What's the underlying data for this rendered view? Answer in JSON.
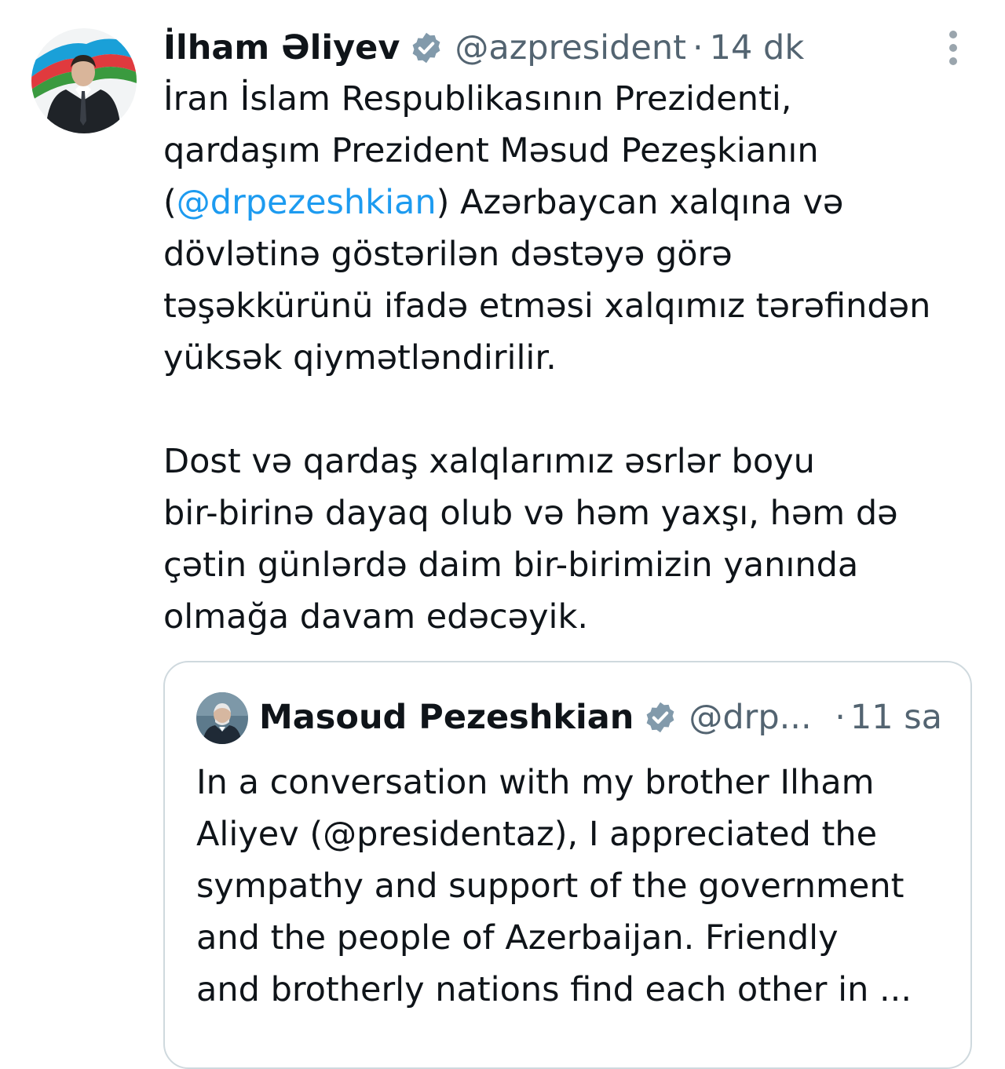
{
  "tweet": {
    "author": {
      "display_name": "İlham Əliyev",
      "handle": "@azpresident",
      "verified": true,
      "avatar_icon": "avatar-ilham-aliyev"
    },
    "separator": "·",
    "time": "14 dk",
    "more_icon": "more-vertical-icon",
    "body": {
      "paragraph1": {
        "line1": "İran İslam Respublikasının Prezidenti,",
        "line2": "qardaşım Prezident Məsud Pezeşkianın",
        "line3_open": "(",
        "line3_mention": "@drpezeshkian",
        "line3_rest": ") Azərbaycan xalqına və",
        "line4": "dövlətinə göstərilən dəstəyə görə",
        "line5": "təşəkkürünü ifadə etməsi xalqımız tərəfindən",
        "line6": "yüksək qiymətləndirilir."
      },
      "paragraph2": {
        "line1": "Dost və qardaş xalqlarımız əsrlər boyu",
        "line2": "bir-birinə dayaq olub və həm yaxşı, həm də",
        "line3": "çətin günlərdə daim bir-birimizin yanında",
        "line4": "olmağa davam edəcəyik."
      }
    },
    "quoted": {
      "author": {
        "display_name": "Masoud Pezeshkian",
        "handle": "@drp...",
        "verified": true,
        "avatar_icon": "avatar-masoud-pezeshkian"
      },
      "separator": "·",
      "time": "11 sa",
      "text": {
        "line1": "In a conversation with my brother Ilham",
        "line2": "Aliyev (@presidentaz), I appreciated the",
        "line3": "sympathy and support of the government",
        "line4": "and the people of Azerbaijan. Friendly",
        "line5": "and brotherly nations find each other in ..."
      }
    }
  },
  "colors": {
    "text_primary": "#0f1419",
    "text_secondary": "#536471",
    "mention_blue": "#1d9bf0",
    "border": "#cfd9de",
    "verified_badge": "#829aab"
  }
}
